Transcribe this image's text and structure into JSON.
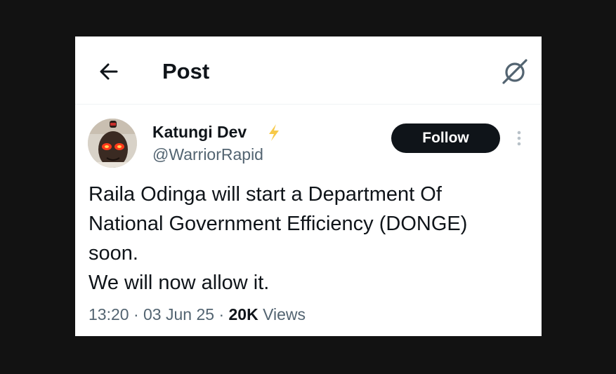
{
  "header": {
    "title": "Post",
    "back_icon": "arrow-left-icon",
    "grok_icon": "grok-icon"
  },
  "post": {
    "author": {
      "display_name": "Katungi Dev",
      "handle": "@WarriorRapid",
      "badge_icon": "lightning-badge-icon",
      "badge_color": "#f7c948"
    },
    "follow_label": "Follow",
    "more_icon": "more-vertical-icon",
    "text_lines": [
      "Raila Odinga will start a Department Of",
      "National Government Efficiency (DONGE)",
      "soon.",
      "We will now allow it."
    ],
    "time": "13:20",
    "date": "03 Jun 25",
    "view_count": "20K",
    "views_label": "Views",
    "separator": "·"
  },
  "colors": {
    "text_primary": "#0f1419",
    "text_secondary": "#536471",
    "follow_bg": "#0f1419",
    "background_outer": "#121212"
  }
}
